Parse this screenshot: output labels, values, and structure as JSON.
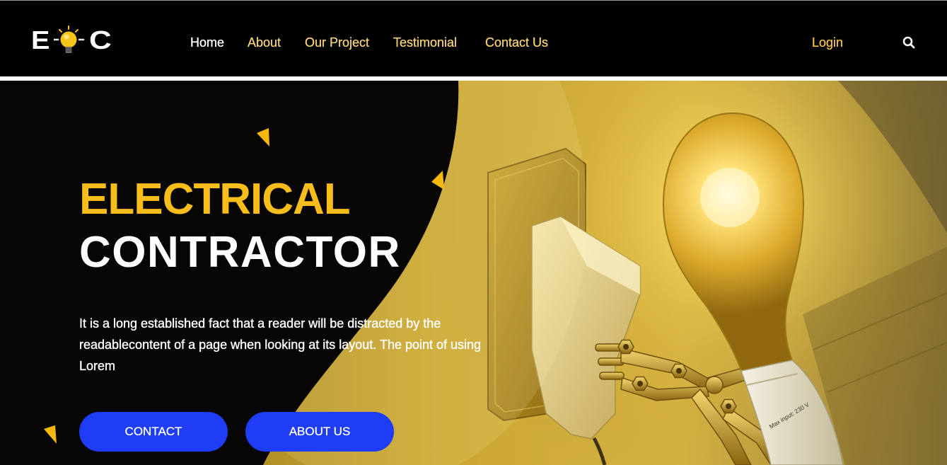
{
  "header": {
    "logo": {
      "letter_left": "E",
      "letter_right": "C",
      "icon": "lightbulb-icon"
    },
    "nav": [
      {
        "label": "Home",
        "active": true
      },
      {
        "label": "About",
        "active": false
      },
      {
        "label": "Our Project",
        "active": false
      },
      {
        "label": "Testimonial",
        "active": false
      },
      {
        "label": "Contact Us",
        "active": false
      }
    ],
    "login_label": "Login",
    "search_icon": "search-icon"
  },
  "hero": {
    "title_line1": "ELECTRICAL",
    "title_line2": "CONTRACTOR",
    "description": "It is a long established fact that a reader will be distracted by the readablecontent of a page when looking at its layout. The point of using Lorem",
    "buttons": [
      {
        "label": "CONTACT"
      },
      {
        "label": "ABOUT US"
      }
    ],
    "photo_text": "Max input: 230 V"
  },
  "colors": {
    "header_background": "#000000",
    "accent_yellow": "#f7bd1b",
    "nav_text": "#f3cf77",
    "nav_active": "#ffffff",
    "login_text": "#f2c047",
    "button_blue": "#1f3df6",
    "hero_dark": "#070605"
  }
}
